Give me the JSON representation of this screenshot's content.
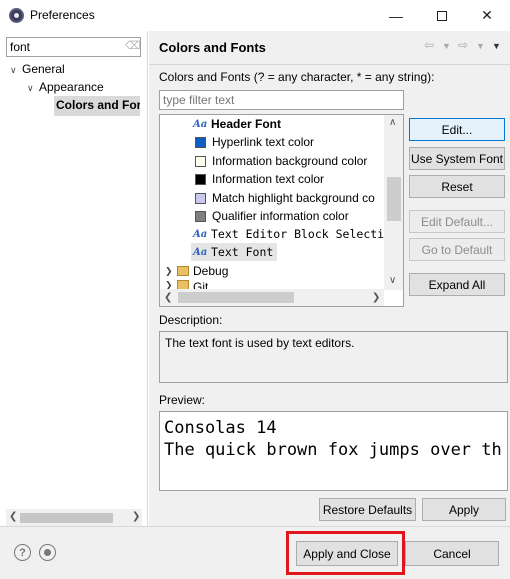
{
  "window": {
    "title": "Preferences"
  },
  "left": {
    "filter_value": "font",
    "tree": [
      {
        "label": "General",
        "level": 0
      },
      {
        "label": "Appearance",
        "level": 1
      },
      {
        "label": "Colors and Fonts",
        "level": 2,
        "display": "Colors and For",
        "selected": true
      }
    ]
  },
  "right": {
    "title": "Colors and Fonts",
    "hint": "Colors and Fonts (? = any character, * = any string):",
    "filter_placeholder": "type filter text",
    "list": [
      {
        "label": "Header Font",
        "kind": "font",
        "bold": true
      },
      {
        "label": "Hyperlink text color",
        "kind": "color",
        "color": "#0b5fc3"
      },
      {
        "label": "Information background color",
        "kind": "color",
        "color": "#fffff0"
      },
      {
        "label": "Information text color",
        "kind": "color",
        "color": "#000000"
      },
      {
        "label": "Match highlight background co",
        "kind": "color",
        "color": "#c8c8f0"
      },
      {
        "label": "Qualifier information color",
        "kind": "color",
        "color": "#808080"
      },
      {
        "label": "Text Editor Block Selection",
        "kind": "font",
        "mono": true
      },
      {
        "label": "Text Font",
        "kind": "font",
        "mono": true,
        "selected": true
      },
      {
        "label": "Debug",
        "kind": "category"
      },
      {
        "label": "Git",
        "kind": "category"
      }
    ],
    "buttons": {
      "edit": "Edit...",
      "use_system_font": "Use System Font",
      "reset": "Reset",
      "edit_default": "Edit Default...",
      "go_to_default": "Go to Default",
      "expand_all": "Expand All"
    },
    "description_label": "Description:",
    "description_text": "The text font is used by text editors.",
    "preview_label": "Preview:",
    "preview_lines": [
      "Consolas 14",
      "The quick brown fox jumps over th"
    ],
    "restore_defaults": "Restore Defaults",
    "apply": "Apply"
  },
  "footer": {
    "apply_and_close": "Apply and Close",
    "cancel": "Cancel"
  },
  "colors": {
    "highlight": "#e0161c",
    "selection": "#d9d9d9",
    "accent": "#0078d7"
  }
}
